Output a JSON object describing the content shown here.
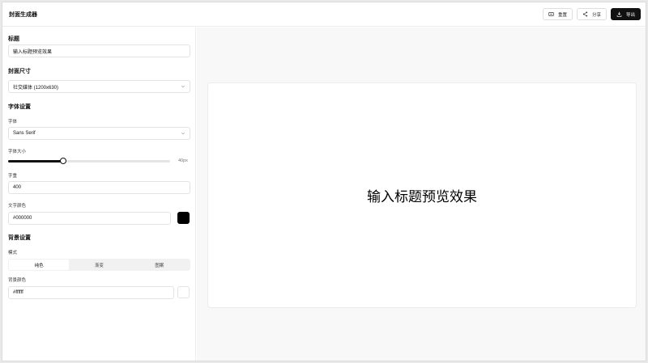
{
  "header": {
    "title": "封面生成器",
    "actions": [
      {
        "label": "重置",
        "icon": "reset-icon"
      },
      {
        "label": "分享",
        "icon": "share-icon"
      },
      {
        "label": "导出",
        "icon": "download-icon"
      }
    ]
  },
  "sidebar": {
    "title_section": {
      "heading": "标题",
      "value": "输入标题预览效果"
    },
    "size_section": {
      "heading": "封面尺寸",
      "selected": "社交媒体 (1200x630)"
    },
    "font_section": {
      "heading": "字体设置",
      "font_label": "字体",
      "font_selected": "Sans Serif",
      "size_label": "字体大小",
      "size_value_text": "40px",
      "size_fraction": 0.34,
      "weight_label": "字重",
      "weight_value": "400",
      "color_label": "文字颜色",
      "color_value": "#000000"
    },
    "bg_section": {
      "heading": "背景设置",
      "mode_label": "模式",
      "modes": [
        "纯色",
        "渐变",
        "图案"
      ],
      "active_mode": 0,
      "color_label": "背景颜色",
      "color_value": "#ffffff"
    }
  },
  "preview": {
    "text": "输入标题预览效果",
    "text_color": "#000000",
    "bg_color": "#ffffff"
  },
  "colors": {
    "accent": "#111111"
  }
}
